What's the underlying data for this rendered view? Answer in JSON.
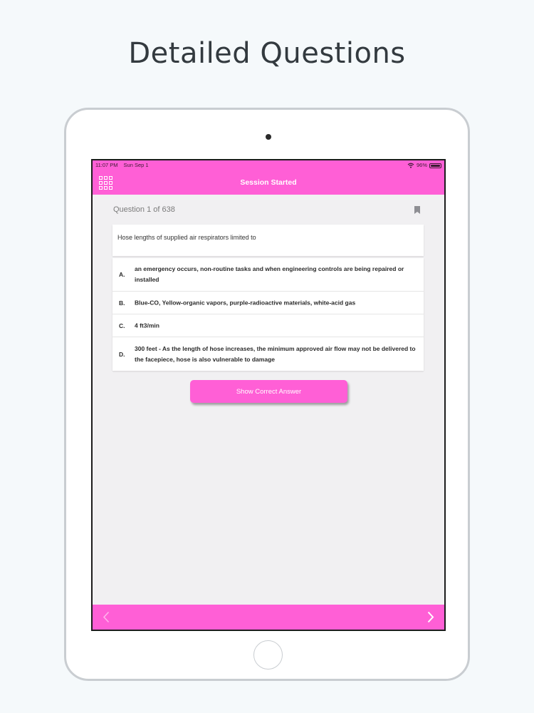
{
  "headline": "Detailed Questions",
  "status": {
    "time": "11:07 PM",
    "date": "Sun Sep 1",
    "battery": "96%"
  },
  "nav": {
    "title": "Session Started",
    "menu_icon": "grid-icon"
  },
  "question": {
    "counter": "Question 1 of 638",
    "text": "Hose lengths of supplied air respirators limited to"
  },
  "options": [
    {
      "letter": "A.",
      "text": "an emergency occurs, non-routine tasks and when engineering controls are being repaired or installed"
    },
    {
      "letter": "B.",
      "text": "Blue-CO, Yellow-organic vapors, purple-radioactive materials, white-acid gas"
    },
    {
      "letter": "C.",
      "text": "4 ft3/min"
    },
    {
      "letter": "D.",
      "text": "300 feet - As the length of hose increases, the minimum approved air flow may not be delivered to the facepiece, hose is also vulnerable to damage"
    }
  ],
  "show_answer_label": "Show Correct Answer",
  "colors": {
    "accent": "#ff5fd6",
    "background": "#f5f9fb",
    "screen_bg": "#f1f0f2"
  },
  "icons": {
    "bookmark": "bookmark-icon",
    "prev": "chevron-left-icon",
    "next": "chevron-right-icon",
    "wifi": "wifi-icon",
    "battery": "battery-icon"
  }
}
